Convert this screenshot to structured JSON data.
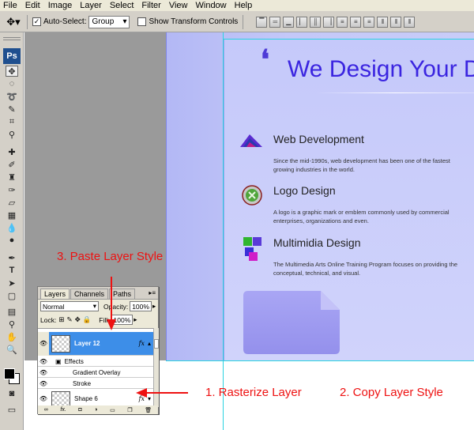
{
  "menu": [
    "File",
    "Edit",
    "Image",
    "Layer",
    "Select",
    "Filter",
    "View",
    "Window",
    "Help"
  ],
  "options": {
    "auto_select_label": "Auto-Select:",
    "auto_select_value": "Group",
    "transform_label": "Show Transform Controls"
  },
  "tools": {
    "logo": "Ps"
  },
  "canvas": {
    "quote_mark": "❛",
    "hero_title": "We Design Your D",
    "services": [
      {
        "title": "Web Development",
        "desc": "Since the mid-1990s, web development has been one of the fastest growing industries in the world."
      },
      {
        "title": "Logo Design",
        "desc": "A logo is a graphic mark or emblem commonly used by commercial enterprises, organizations and even."
      },
      {
        "title": "Multimidia Design",
        "desc": "The Multimedia Arts Online Training Program focuses on providing the conceptual, technical, and visual."
      }
    ]
  },
  "layers_panel": {
    "tabs": [
      "Layers",
      "Channels",
      "Paths"
    ],
    "blend_mode": "Normal",
    "opacity_label": "Opacity:",
    "opacity_value": "100%",
    "lock_label": "Lock:",
    "fill_label": "Fill:",
    "fill_value": "100%",
    "layers": [
      {
        "name": "Layer 12",
        "selected": true,
        "fx": "fx"
      },
      {
        "name": "Effects"
      },
      {
        "name": "Gradient Overlay"
      },
      {
        "name": "Stroke"
      },
      {
        "name": "Shape 6",
        "fx": "fx"
      }
    ]
  },
  "annotations": {
    "step3": "3. Paste Layer Style",
    "step1": "1. Rasterize Layer",
    "step2": "2. Copy Layer Style"
  },
  "colors": {
    "accent": "#3b25e0",
    "annotation": "#ee1111",
    "selected_layer": "#3d8ee8"
  }
}
